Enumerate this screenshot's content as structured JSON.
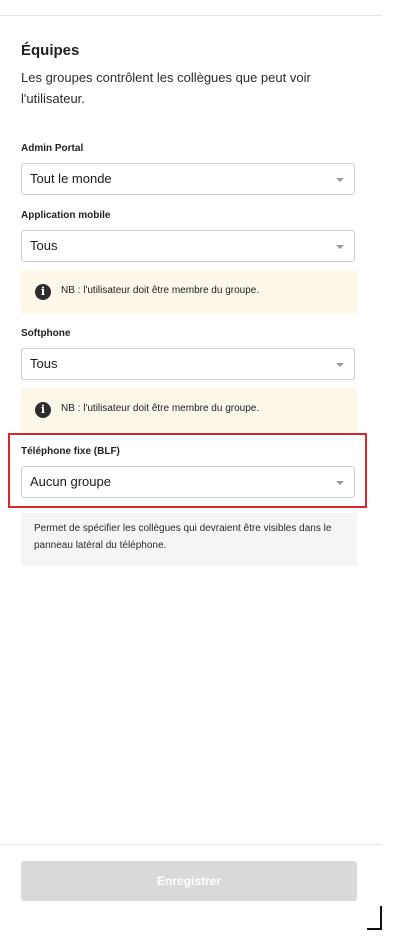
{
  "section": {
    "title": "Équipes",
    "description": "Les groupes contrôlent les collègues que peut voir l'utilisateur."
  },
  "fields": {
    "admin_portal": {
      "label": "Admin Portal",
      "value": "Tout le monde"
    },
    "mobile_app": {
      "label": "Application mobile",
      "value": "Tous",
      "note": "NB : l'utilisateur doit être membre du groupe."
    },
    "softphone": {
      "label": "Softphone",
      "value": "Tous",
      "note": "NB : l'utilisateur doit être membre du groupe."
    },
    "desk_phone": {
      "label": "Téléphone fixe (BLF)",
      "value": "Aucun groupe",
      "help": "Permet de spécifier les collègues qui devraient être visibles dans le panneau latéral du téléphone."
    }
  },
  "footer": {
    "save_label": "Enregistrer"
  },
  "icons": {
    "info": "info-icon",
    "dropdown": "chevron-down-icon"
  },
  "colors": {
    "highlight_border": "#d9262e",
    "note_background": "#fdf7e9",
    "disabled_button": "#d9d9d9"
  }
}
